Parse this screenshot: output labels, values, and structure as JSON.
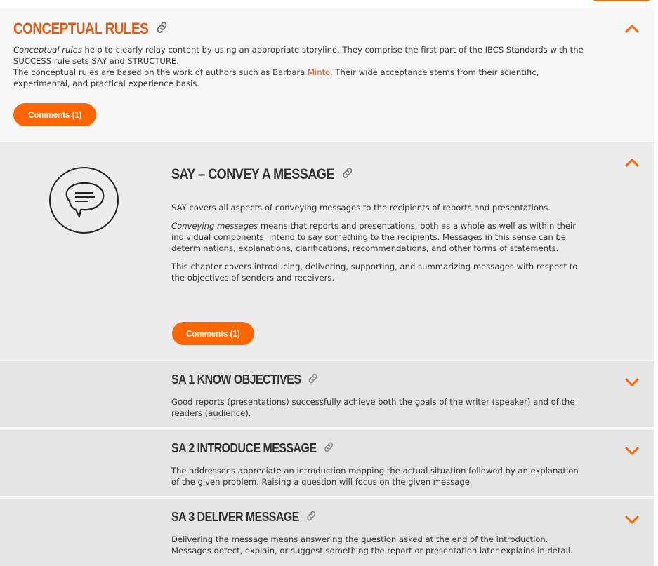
{
  "conceptual": {
    "title": "CONCEPTUAL RULES",
    "intro_em": "Conceptual rules",
    "intro_rest": " help to clearly relay content by using an appropriate storyline. They comprise the first part of the IBCS Standards with the SUCCESS rule sets SAY and STRUCTURE.",
    "line2_pre": "The conceptual rules are based on the work of authors such as Barbara ",
    "line2_link": "Minto",
    "line2_post": ". Their wide acceptance stems from their scientific, experimental, and practical experience basis.",
    "comments_label": "Comments (1)"
  },
  "say": {
    "title": "SAY – CONVEY A MESSAGE",
    "p1": "SAY covers all aspects of conveying messages to the recipients of reports and presentations.",
    "p2_em": "Conveying messages",
    "p2_rest": " means that reports and presentations, both as a whole as well as within their individual components, intend to say something to the recipients. Messages in this sense can be determinations, explanations, clarifications, recommendations, and other forms of statements.",
    "p3": "This chapter covers introducing, delivering, supporting, and summarizing messages with respect to the objectives of senders and receivers.",
    "comments_label": "Comments (1)"
  },
  "rules": [
    {
      "title": "SA 1 KNOW OBJECTIVES",
      "text": "Good reports (presentations) successfully achieve both the goals of the writer (speaker) and of the readers (audience)."
    },
    {
      "title": "SA 2 INTRODUCE MESSAGE",
      "text": "The addressees appreciate an introduction mapping the actual situation followed by an explanation of the given problem. Raising a question will focus on the given message."
    },
    {
      "title": "SA 3 DELIVER MESSAGE",
      "text": "Delivering the message means answering the question asked at the end of the introduction. Messages detect, explain, or suggest something the report or presentation later explains in detail."
    }
  ],
  "icons": {
    "link": "link-icon",
    "collapse": "chevron-up-icon",
    "expand": "chevron-down-icon",
    "message": "speech-bubble-icon"
  },
  "colors": {
    "accent": "#ff6600",
    "title_orange": "#e05a12"
  }
}
